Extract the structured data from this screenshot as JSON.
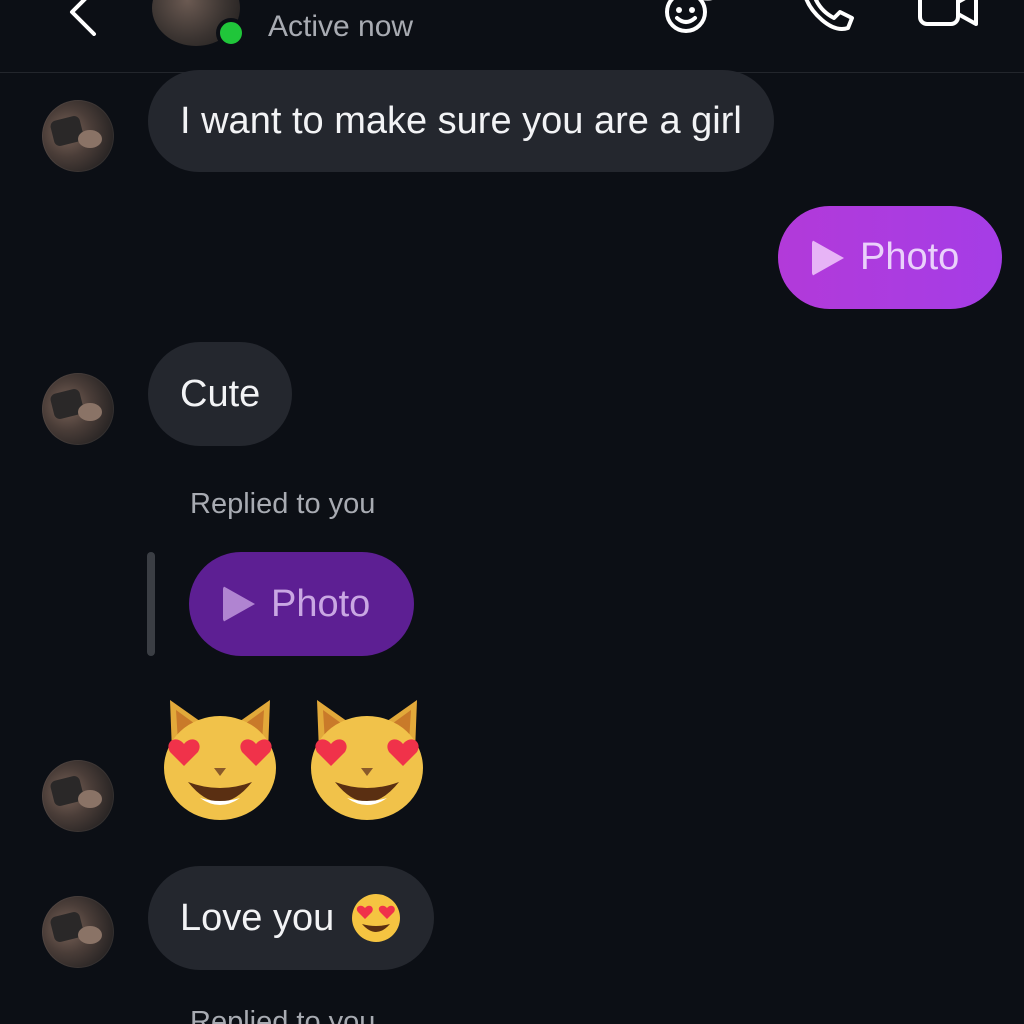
{
  "header": {
    "status": "Active now",
    "icons": [
      "back-chevron-icon",
      "sticker-icon",
      "phone-icon",
      "video-camera-icon"
    ],
    "online_color": "#20c63a"
  },
  "messages": [
    {
      "from": "them",
      "type": "text",
      "text": "I want to make sure you are a girl"
    },
    {
      "from": "me",
      "type": "media",
      "label": "Photo",
      "icon": "play-icon",
      "color": "#b23ad9"
    },
    {
      "from": "them",
      "type": "text",
      "text": "Cute"
    },
    {
      "from": "them",
      "type": "reply",
      "reply_label": "Replied to you",
      "quoted": {
        "label": "Photo",
        "icon": "play-icon",
        "color": "#5d1f93"
      }
    },
    {
      "from": "them",
      "type": "emoji",
      "emoji": [
        "heart-eyes-cat-icon",
        "heart-eyes-cat-icon"
      ]
    },
    {
      "from": "them",
      "type": "text",
      "text": "Love you",
      "emoji": "heart-eyes-face-icon"
    },
    {
      "from": "them",
      "type": "reply",
      "reply_label": "Replied to you"
    }
  ]
}
